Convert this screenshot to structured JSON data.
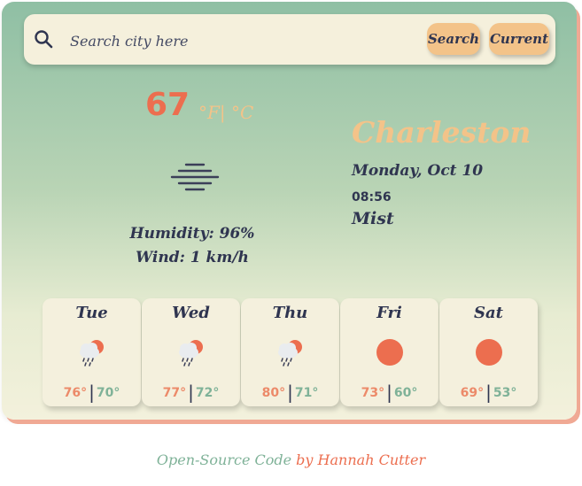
{
  "search": {
    "placeholder": "Search city here",
    "search_label": "Search",
    "current_label": "Current"
  },
  "current": {
    "temperature": "67",
    "units": "°F| °C",
    "humidity": "Humidity: 96%",
    "wind": "Wind: 1 km/h",
    "icon": "mist-icon"
  },
  "location": {
    "city": "Charleston",
    "date": "Monday, Oct 10",
    "time": "08:56",
    "description": "Mist"
  },
  "forecast": [
    {
      "day": "Tue",
      "high": "76°",
      "low": "70°",
      "icon": "rain-cloud-sun-icon"
    },
    {
      "day": "Wed",
      "high": "77°",
      "low": "72°",
      "icon": "rain-cloud-sun-icon"
    },
    {
      "day": "Thu",
      "high": "80°",
      "low": "71°",
      "icon": "rain-cloud-sun-icon"
    },
    {
      "day": "Fri",
      "high": "73°",
      "low": "60°",
      "icon": "sun-icon"
    },
    {
      "day": "Sat",
      "high": "69°",
      "low": "53°",
      "icon": "sun-icon"
    }
  ],
  "footer": {
    "source_link": "Open-Source Code",
    "by_text": "by",
    "author_link": "Hannah Cutter"
  },
  "colors": {
    "accent": "#ec6e4f",
    "highlight": "#f3c389",
    "teal": "#7fb298",
    "text": "#2f3550"
  }
}
